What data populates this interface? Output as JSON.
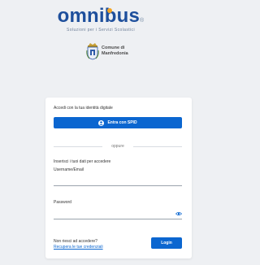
{
  "brand": {
    "name_part1": "omni",
    "name_part2": "bus",
    "registered_mark": "®",
    "tagline": "Soluzioni per i Servizi Scolastici",
    "colors": {
      "primary": "#1e4f9c",
      "accent": "#f5a623"
    }
  },
  "municipality": {
    "line1": "Comune di",
    "line2": "Manfredonia",
    "crest_icon": "municipal-crest-icon"
  },
  "login_card": {
    "digital_identity_label": "Accedi con la tua identità digitale",
    "spid_button_label": "Entra con SPID",
    "spid_icon": "spid-user-icon",
    "divider_text": "oppure",
    "credentials_heading": "Inserisci i tuoi dati per accedere",
    "username_label": "Username/Email",
    "username_value": "",
    "password_label": "Password",
    "password_value": "",
    "show_password_icon": "eye-icon",
    "help_question": "Non riesci ad accedere?",
    "recover_link": "Recupera le tue credenziali",
    "login_button_label": "Login",
    "button_color": "#0b66d0"
  }
}
